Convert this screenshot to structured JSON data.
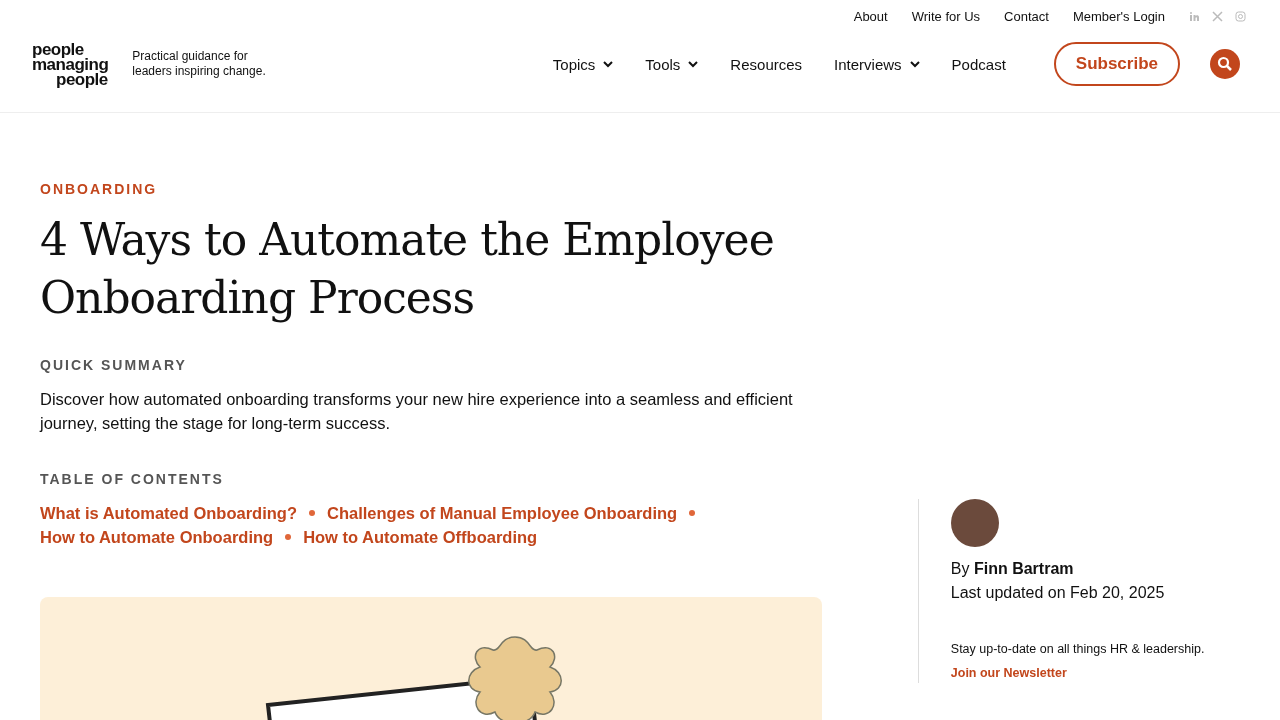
{
  "top_links": [
    "About",
    "Write for Us",
    "Contact",
    "Member's Login"
  ],
  "logo": {
    "lines": [
      "people",
      "managing",
      "people"
    ]
  },
  "tagline": "Practical guidance for leaders inspiring change.",
  "nav": [
    {
      "label": "Topics",
      "dropdown": true
    },
    {
      "label": "Tools",
      "dropdown": true
    },
    {
      "label": "Resources",
      "dropdown": false
    },
    {
      "label": "Interviews",
      "dropdown": true
    },
    {
      "label": "Podcast",
      "dropdown": false
    }
  ],
  "subscribe": "Subscribe",
  "article": {
    "category": "ONBOARDING",
    "title": "4 Ways to Automate the Employee Onboarding Process",
    "summary_heading": "QUICK SUMMARY",
    "summary": "Discover how automated onboarding transforms your new hire experience into a seamless and efficient journey, setting the stage for long-term success.",
    "toc_heading": "TABLE OF CONTENTS",
    "toc": [
      "What is Automated Onboarding?",
      "Challenges of Manual Employee Onboarding",
      "How to Automate Onboarding",
      "How to Automate Offboarding"
    ]
  },
  "author": {
    "byline": "By **Finn Bartram**",
    "updated": "Last updated on Feb 20, 2025"
  },
  "newsletter": {
    "text": "Stay up-to-date on all things HR & leadership.",
    "link": "Join our Newsletter"
  }
}
